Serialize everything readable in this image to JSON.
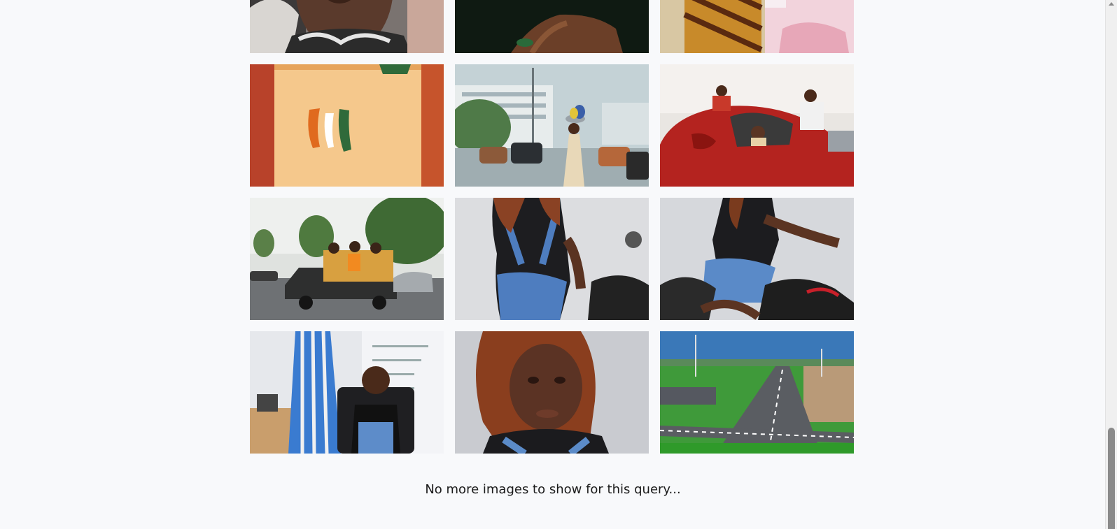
{
  "results": {
    "end_message": "No more images to show for this query...",
    "images": [
      {
        "subject": "child-face",
        "row": 0
      },
      {
        "subject": "dark-shoulder",
        "row": 0
      },
      {
        "subject": "children-dresses",
        "row": 0
      },
      {
        "subject": "flag-shirt",
        "row": 1
      },
      {
        "subject": "rainy-street-vendor",
        "row": 1
      },
      {
        "subject": "red-car-celebration",
        "row": 1
      },
      {
        "subject": "pickup-truck-parade",
        "row": 2
      },
      {
        "subject": "denim-overalls-back",
        "row": 2
      },
      {
        "subject": "denim-overalls-motorbike",
        "row": 2
      },
      {
        "subject": "office-portrait",
        "row": 3
      },
      {
        "subject": "braids-portrait",
        "row": 3
      },
      {
        "subject": "aerial-road",
        "row": 3
      }
    ]
  },
  "colors": {
    "background": "#f8f9fb",
    "text": "#1a1a1a",
    "scrollbar_thumb": "#8a8a8a"
  }
}
